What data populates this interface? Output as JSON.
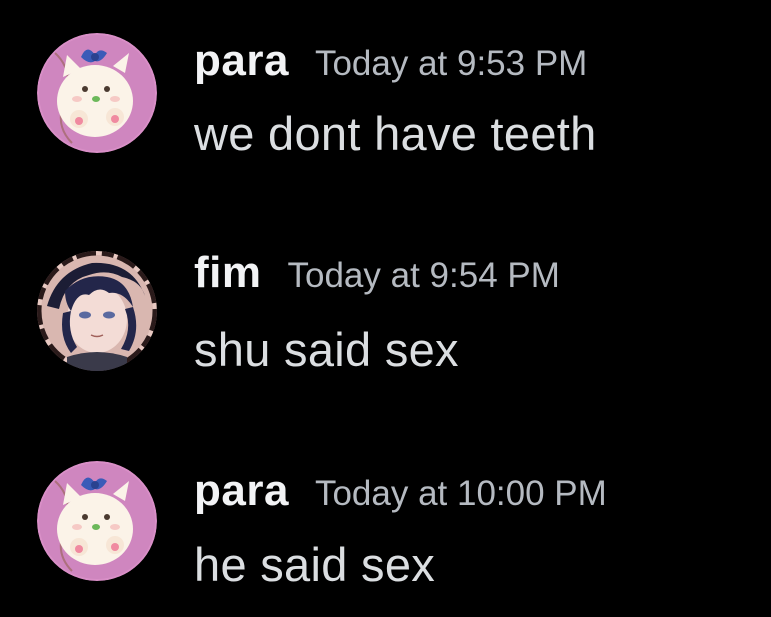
{
  "messages": [
    {
      "username": "para",
      "timestamp": "Today at 9:53 PM",
      "content": "we dont have teeth",
      "avatar": "cat-plush-avatar"
    },
    {
      "username": "fim",
      "timestamp": "Today at 9:54 PM",
      "content": "shu said sex",
      "avatar": "anime-character-avatar"
    },
    {
      "username": "para",
      "timestamp": "Today at 10:00 PM",
      "content": "he said sex",
      "avatar": "cat-plush-avatar"
    }
  ],
  "colors": {
    "background": "#000000",
    "username": "#f2f3f5",
    "timestamp": "#b5bac1",
    "content": "#dbdee1"
  }
}
